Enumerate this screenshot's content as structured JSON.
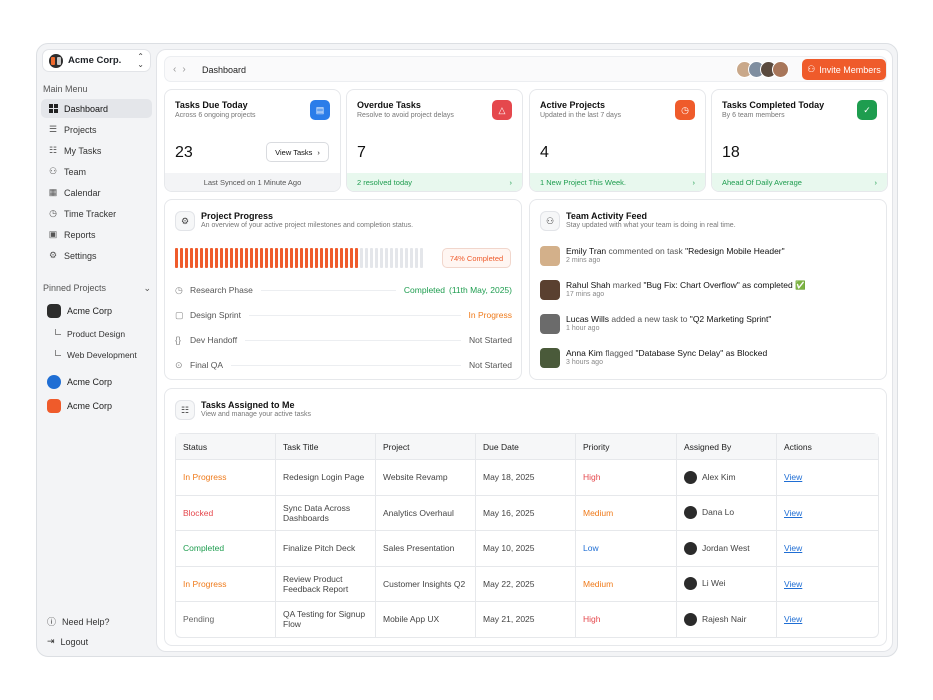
{
  "workspace": {
    "name": "Acme Corp."
  },
  "sidebar": {
    "main_menu_label": "Main Menu",
    "items": [
      {
        "label": "Dashboard",
        "icon": "grid-icon"
      },
      {
        "label": "Projects",
        "icon": "list-icon"
      },
      {
        "label": "My Tasks",
        "icon": "checklist-icon"
      },
      {
        "label": "Team",
        "icon": "team-icon"
      },
      {
        "label": "Calendar",
        "icon": "calendar-icon"
      },
      {
        "label": "Time Tracker",
        "icon": "timer-icon"
      },
      {
        "label": "Reports",
        "icon": "reports-icon"
      },
      {
        "label": "Settings",
        "icon": "gear-icon"
      }
    ],
    "pinned_label": "Pinned Projects",
    "pinned": [
      {
        "label": "Acme Corp",
        "color": "#2d2d2d"
      },
      {
        "label": "Acme Corp",
        "color": "#1f6ed4"
      },
      {
        "label": "Acme Corp",
        "color": "#ef5b2b"
      }
    ],
    "sub_items": [
      "Product Design",
      "Web Development"
    ],
    "footer": [
      "Need Help?",
      "Logout"
    ]
  },
  "topbar": {
    "breadcrumb": "Dashboard",
    "invite_label": "Invite Members"
  },
  "cards": [
    {
      "title": "Tasks Due Today",
      "sub": "Across 6 ongoing projects",
      "value": "23",
      "button": "View Tasks",
      "footer": "Last Synced on 1 Minute Ago",
      "color": "#2b7de9",
      "icon": "note-icon"
    },
    {
      "title": "Overdue Tasks",
      "sub": "Resolve to avoid project delays",
      "value": "7",
      "footer": "2 resolved today",
      "color": "#e5484d",
      "icon": "alert-icon"
    },
    {
      "title": "Active Projects",
      "sub": "Updated in the last 7 days",
      "value": "4",
      "footer": "1 New Project This Week.",
      "color": "#ef5b2b",
      "icon": "clock-icon"
    },
    {
      "title": "Tasks Completed Today",
      "sub": "By 6 team members",
      "value": "18",
      "footer": "Ahead Of Daily Average",
      "color": "#1e9d4f",
      "icon": "check-icon"
    }
  ],
  "progress": {
    "title": "Project Progress",
    "sub": "An overview of your active project milestones and completion status.",
    "percent_label": "74% Completed",
    "percent": 0.74,
    "phases": [
      {
        "name": "Research Phase",
        "status": "Completed",
        "date": "(11th May, 2025)",
        "color": "#1e9d4f"
      },
      {
        "name": "Design Sprint",
        "status": "In Progress",
        "color": "#ef7a1a"
      },
      {
        "name": "Dev Handoff",
        "status": "Not Started",
        "color": "#555555"
      },
      {
        "name": "Final QA",
        "status": "Not Started",
        "color": "#555555"
      }
    ]
  },
  "feed": {
    "title": "Team Activity Feed",
    "sub": "Stay updated with what your team is doing in real time.",
    "items": [
      {
        "who": "Emily Tran",
        "action": " commented on task ",
        "target": "\"Redesign Mobile Header\"",
        "time": "2 mins ago",
        "suffix": ""
      },
      {
        "who": "Rahul Shah",
        "action": " marked ",
        "target": "\"Bug Fix: Chart Overflow\" as completed",
        "time": "17 mins ago",
        "suffix": "✅"
      },
      {
        "who": "Lucas Wills",
        "action": " added a new task to ",
        "target": "\"Q2 Marketing Sprint\"",
        "time": "1 hour ago",
        "suffix": ""
      },
      {
        "who": "Anna Kim",
        "action": " flagged ",
        "target": "\"Database Sync Delay\" as Blocked",
        "time": "3 hours ago",
        "suffix": ""
      }
    ]
  },
  "tasks": {
    "title": "Tasks Assigned to Me",
    "sub": "View and manage your active tasks",
    "columns": [
      "Status",
      "Task Title",
      "Project",
      "Due Date",
      "Priority",
      "Assigned By",
      "Actions"
    ],
    "rows": [
      {
        "status": "In Progress",
        "title": "Redesign Login Page",
        "project": "Website Revamp",
        "due": "May 18, 2025",
        "priority": "High",
        "by": "Alex Kim",
        "action": "View"
      },
      {
        "status": "Blocked",
        "title": "Sync Data Across Dashboards",
        "project": "Analytics Overhaul",
        "due": "May 16, 2025",
        "priority": "Medium",
        "by": "Dana Lo",
        "action": "View"
      },
      {
        "status": "Completed",
        "title": "Finalize Pitch Deck",
        "project": "Sales Presentation",
        "due": "May 10, 2025",
        "priority": "Low",
        "by": "Jordan West",
        "action": "View"
      },
      {
        "status": "In Progress",
        "title": "Review Product Feedback Report",
        "project": "Customer Insights Q2",
        "due": "May 22, 2025",
        "priority": "Medium",
        "by": "Li Wei",
        "action": "View"
      },
      {
        "status": "Pending",
        "title": "QA Testing for Signup Flow",
        "project": "Mobile App UX",
        "due": "May 21, 2025",
        "priority": "High",
        "by": "Rajesh Nair",
        "action": "View"
      }
    ]
  },
  "colors": {
    "accent": "#ef5b2b",
    "in_progress": "#ef7a1a",
    "blocked": "#e5484d",
    "completed": "#1e9d4f",
    "pending": "#666666",
    "high": "#e5484d",
    "medium": "#ef7a1a",
    "low": "#1f6ed4"
  }
}
